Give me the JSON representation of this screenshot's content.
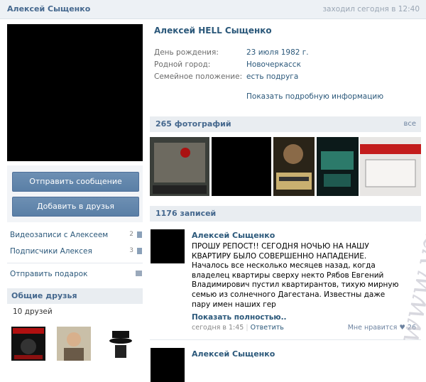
{
  "header": {
    "name": "Алексей Сыщенко",
    "status": "заходил сегодня в 12:40"
  },
  "actions": {
    "send_message": "Отправить сообщение",
    "add_friend": "Добавить в друзья"
  },
  "left_menu": {
    "videos": {
      "label": "Видеозаписи с Алексеем",
      "count": "2"
    },
    "subscribers": {
      "label": "Подписчики Алексея",
      "count": "3"
    },
    "gift": {
      "label": "Отправить подарок"
    }
  },
  "friends": {
    "title": "Общие друзья",
    "count": "10 друзей"
  },
  "profile": {
    "name": "Алексей HELL Сыщенко",
    "fields": [
      {
        "label": "День рождения:",
        "value": "23 июля 1982 г."
      },
      {
        "label": "Родной город:",
        "value": "Новочеркасск"
      },
      {
        "label": "Семейное положение:",
        "value": "есть подруга"
      }
    ],
    "show_more": "Показать подробную информацию"
  },
  "photos": {
    "title": "265 фотографий",
    "all": "все"
  },
  "wall": {
    "title": "1176 записей",
    "post": {
      "author": "Алексей Сыщенко",
      "text": "ПРОШУ РЕПОСТ!! СЕГОДНЯ НОЧЬЮ НА НАШУ КВАРТИРУ БЫЛО СОВЕРШЕННО НАПАДЕНИЕ. Началось все несколько месяцев назад, когда владелец квартиры сверху некто Рябов Евгений Владимирович пустил квартирантов, тихую мирную семью из солнечного Дагестана. Известны даже пару имен наших гер",
      "more": "Показать полностью..",
      "time": "сегодня в 1:45",
      "reply": "Ответить",
      "like": "Мне нравится",
      "like_count": "26"
    },
    "post2_author": "Алексей Сыщенко"
  },
  "watermark": "www.vzsar.ru",
  "colors": {
    "link": "#2b587a",
    "header_bg": "#edf1f5",
    "button": "#5a7fa6",
    "section_bg": "#e9edf1"
  }
}
